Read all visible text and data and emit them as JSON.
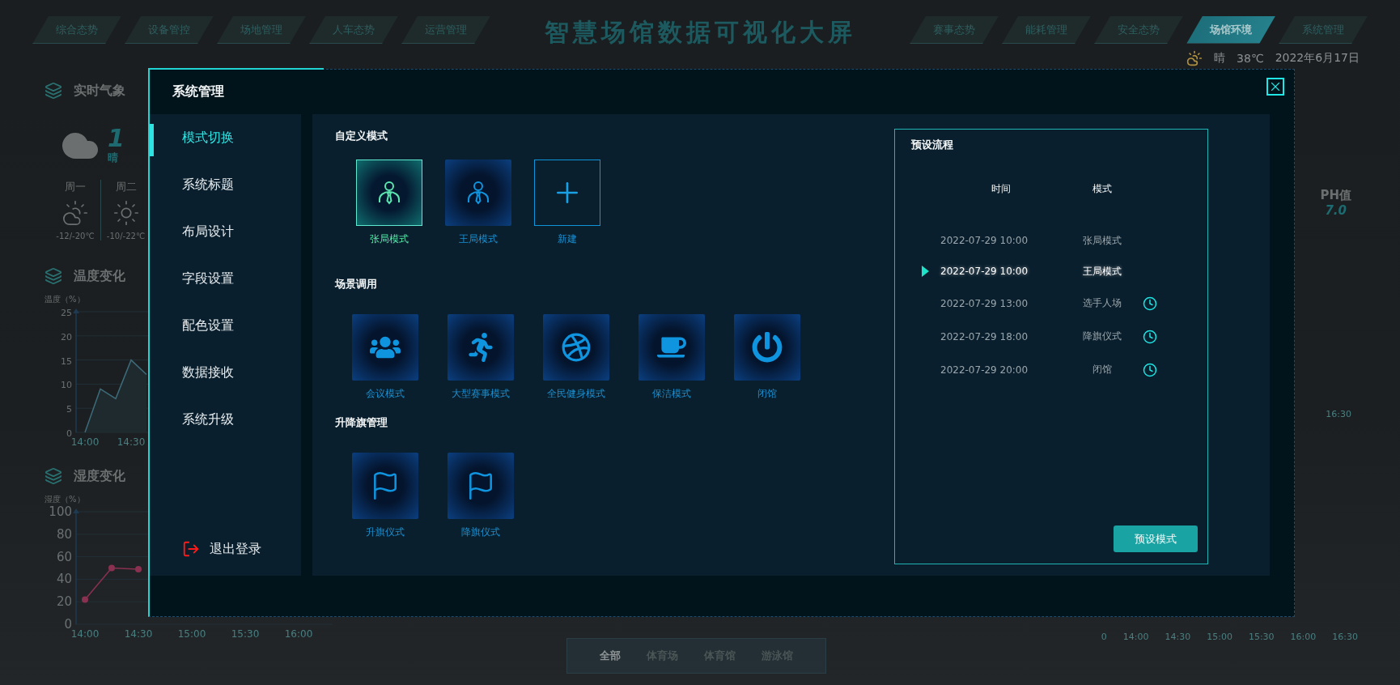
{
  "top_nav": {
    "title": "智慧场馆数据可视化大屏",
    "left_tabs": [
      {
        "label": "综合态势",
        "selected": false
      },
      {
        "label": "设备管控",
        "selected": false
      },
      {
        "label": "场地管理",
        "selected": false
      },
      {
        "label": "人车态势",
        "selected": false
      },
      {
        "label": "运营管理",
        "selected": false
      }
    ],
    "right_tabs": [
      {
        "label": "赛事态势",
        "selected": false
      },
      {
        "label": "能耗管理",
        "selected": false
      },
      {
        "label": "安全态势",
        "selected": false
      },
      {
        "label": "场馆环境",
        "selected": true
      },
      {
        "label": "系统管理",
        "selected": false
      }
    ]
  },
  "weather_bar": {
    "condition": "晴",
    "temperature": "38℃",
    "date": "2022年6月17日"
  },
  "left_panel": {
    "weather": {
      "title": "实时气象",
      "current_temp": "1",
      "current_desc": "晴",
      "forecast": [
        {
          "day": "周一",
          "kind": "partly-cloudy",
          "range": "-12/-20℃"
        },
        {
          "day": "周二",
          "kind": "sunny",
          "range": "-10/-22℃"
        }
      ]
    },
    "temperature": {
      "title": "温度变化",
      "chart_data": {
        "type": "area",
        "ylabel": "温度（%）",
        "categories": [
          "14:00",
          null,
          null,
          "14:30",
          null
        ],
        "series": [
          {
            "color": "#3d6b7a",
            "values": [
              0,
              9,
              7,
              15,
              12
            ]
          }
        ],
        "grid": true,
        "ylim": [
          0,
          25
        ],
        "yticks": [
          0,
          5,
          10,
          15,
          20,
          25
        ]
      }
    },
    "humidity": {
      "title": "湿度变化",
      "chart_data": {
        "type": "line",
        "ylabel": "湿度（%）",
        "categories": [
          "14:00",
          null,
          "14:30",
          null,
          "15:00",
          null,
          "15:30",
          null,
          "16:00"
        ],
        "series": [
          {
            "color": "#8a3050",
            "marker": true,
            "values": [
              22,
              50,
              49,
              null,
              null,
              null,
              null,
              null,
              null
            ]
          }
        ],
        "grid": true,
        "ylim": [
          0,
          100
        ],
        "yticks": [
          0,
          20,
          40,
          60,
          80,
          100
        ]
      }
    }
  },
  "right_panel": {
    "ph": {
      "label": "PH值",
      "value": "7.0"
    },
    "trend_axis_label": "16:30",
    "bottom_axis": {
      "y_label": "0",
      "x_labels": [
        "14:00",
        "14:30",
        "15:00",
        "15:30",
        "16:00",
        "16:30"
      ]
    }
  },
  "area_filter": [
    {
      "label": "全部",
      "selected": true
    },
    {
      "label": "体育场",
      "selected": false
    },
    {
      "label": "体育馆",
      "selected": false
    },
    {
      "label": "游泳馆",
      "selected": false
    }
  ],
  "dialog": {
    "title": "系统管理",
    "menu": [
      {
        "label": "模式切换",
        "selected": true
      },
      {
        "label": "系统标题",
        "selected": false
      },
      {
        "label": "布局设计",
        "selected": false
      },
      {
        "label": "字段设置",
        "selected": false
      },
      {
        "label": "配色设置",
        "selected": false
      },
      {
        "label": "数据接收",
        "selected": false
      },
      {
        "label": "系统升级",
        "selected": false
      }
    ],
    "logout": "退出登录",
    "sections": [
      {
        "title": "自定义模式",
        "tiles": [
          {
            "kind": "person",
            "label": "张局模式",
            "selected": true
          },
          {
            "kind": "person",
            "label": "王局模式",
            "selected": false
          },
          {
            "kind": "add",
            "label": "新建",
            "selected": false
          }
        ]
      },
      {
        "title": "场景调用",
        "tiles": [
          {
            "kind": "group",
            "label": "会议模式",
            "selected": false
          },
          {
            "kind": "run",
            "label": "大型赛事模式",
            "selected": false
          },
          {
            "kind": "ball",
            "label": "全民健身模式",
            "selected": false
          },
          {
            "kind": "cup",
            "label": "保洁模式",
            "selected": false
          },
          {
            "kind": "power",
            "label": "闭馆",
            "selected": false
          }
        ]
      },
      {
        "title": "升降旗管理",
        "tiles": [
          {
            "kind": "flag",
            "label": "升旗仪式",
            "selected": false
          },
          {
            "kind": "flag",
            "label": "降旗仪式",
            "selected": false
          }
        ]
      }
    ],
    "preset": {
      "title": "预设流程",
      "columns": [
        "时间",
        "模式"
      ],
      "rows": [
        {
          "time": "2022-07-29 10:00",
          "mode": "张局模式",
          "current": false,
          "scheduled": false
        },
        {
          "time": "2022-07-29 10:00",
          "mode": "王局模式",
          "current": true,
          "scheduled": false
        },
        {
          "time": "2022-07-29 13:00",
          "mode": "选手人场",
          "current": false,
          "scheduled": true
        },
        {
          "time": "2022-07-29 18:00",
          "mode": "降旗仪式",
          "current": false,
          "scheduled": true
        },
        {
          "time": "2022-07-29 20:00",
          "mode": "闭馆",
          "current": false,
          "scheduled": true
        }
      ],
      "button": "预设模式"
    }
  }
}
